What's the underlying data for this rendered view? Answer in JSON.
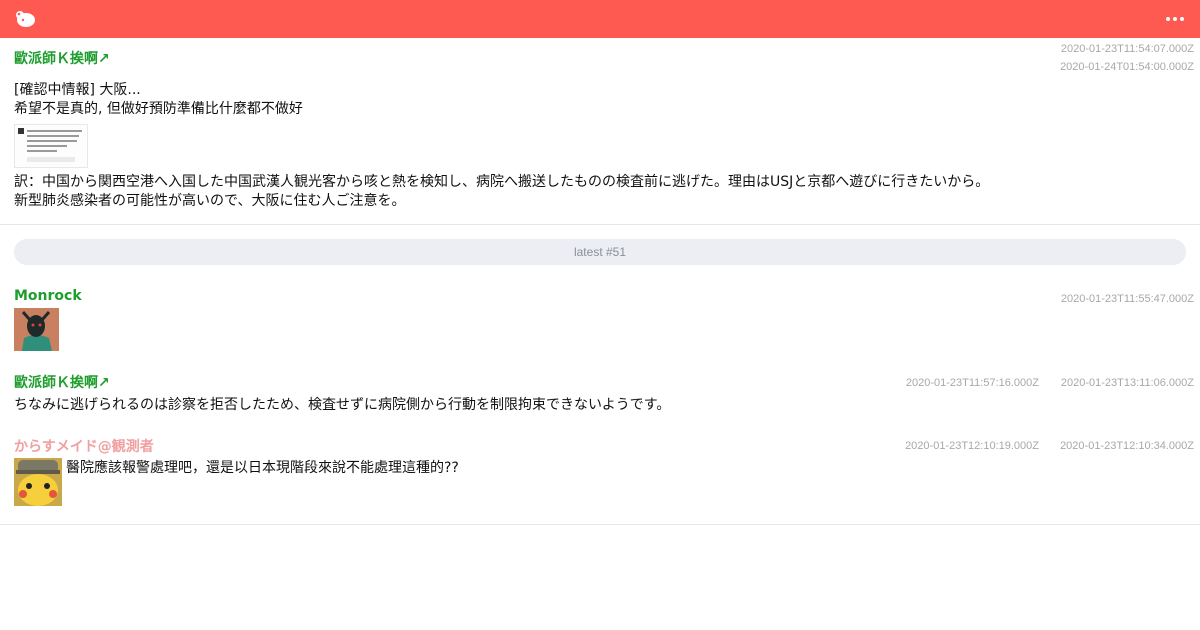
{
  "icons": {
    "logo": "sheep-logo-icon",
    "menu": "more-horizontal-icon"
  },
  "colors": {
    "topbar": "#ff5a52",
    "author_green": "#1e9e2c",
    "author_pink": "#f0a0a0"
  },
  "posts": [
    {
      "author": "歐派師Ｋ挨啊↗",
      "timestamps": [
        "2020-01-23T11:54:07.000Z",
        "2020-01-24T01:54:00.000Z"
      ],
      "lines": [
        "[確認中情報] 大阪...",
        "希望不是真的, 但做好預防準備比什麼都不做好",
        "訳：中国から関西空港へ入国した中国武漢人観光客から咳と熱を検知し、病院へ搬送したものの検査前に逃げた。理由はUSJと京都へ遊びに行きたいから。",
        "新型肺炎感染者の可能性が高いので、大阪に住む人ご注意を。"
      ]
    },
    {
      "author": "Monrock",
      "timestamps": [
        "2020-01-23T11:55:47.000Z"
      ]
    },
    {
      "author": "歐派師Ｋ挨啊↗",
      "timestamps": [
        "2020-01-23T11:57:16.000Z",
        "2020-01-23T13:11:06.000Z"
      ],
      "lines": [
        "ちなみに逃げられるのは診察を拒否したため、検査せずに病院側から行動を制限拘束できないようです。"
      ]
    },
    {
      "author": "からすメイド@観測者",
      "timestamps": [
        "2020-01-23T12:10:19.000Z",
        "2020-01-23T12:10:34.000Z"
      ],
      "lines": [
        "醫院應該報警處理吧，還是以日本現階段來說不能處理這種的??"
      ]
    }
  ],
  "latest_label": "latest #51"
}
